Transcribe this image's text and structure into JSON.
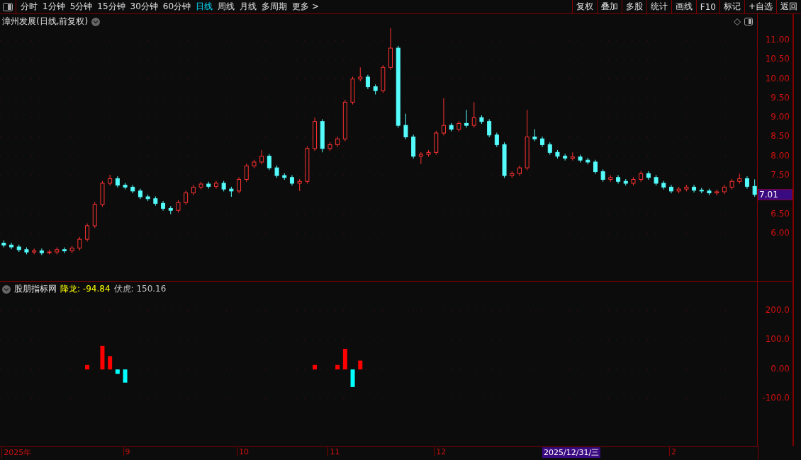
{
  "toolbar": {
    "periods": [
      {
        "label": "分时",
        "selected": false
      },
      {
        "label": "1分钟",
        "selected": false
      },
      {
        "label": "5分钟",
        "selected": false
      },
      {
        "label": "15分钟",
        "selected": false
      },
      {
        "label": "30分钟",
        "selected": false
      },
      {
        "label": "60分钟",
        "selected": false
      },
      {
        "label": "日线",
        "selected": true
      },
      {
        "label": "周线",
        "selected": false
      },
      {
        "label": "月线",
        "selected": false
      },
      {
        "label": "多周期",
        "selected": false
      },
      {
        "label": "更多 >",
        "selected": false
      }
    ],
    "buttons": [
      "复权",
      "叠加",
      "多股",
      "统计",
      "画线",
      "F10",
      "标记",
      "+自选",
      "返回"
    ]
  },
  "price_panel": {
    "title": "漳州发展(日线,前复权)",
    "current_price": "7.01",
    "chart_data": {
      "type": "candlestick",
      "categories": [
        null,
        null,
        null,
        null,
        null,
        null,
        null,
        null,
        null,
        null,
        null,
        null,
        null,
        null,
        null,
        null,
        null,
        null,
        null,
        null,
        null,
        null,
        null,
        null,
        null,
        null,
        null,
        null,
        null,
        null,
        null,
        null,
        null,
        null,
        null,
        null,
        null,
        null,
        null,
        null,
        null,
        null,
        null,
        null,
        null,
        null,
        null,
        null,
        null,
        null,
        null,
        null,
        null,
        null,
        null,
        null,
        null,
        null,
        null,
        null,
        null,
        null,
        null,
        null,
        null,
        null,
        null,
        null,
        null,
        null,
        null,
        null,
        null,
        null,
        null,
        null,
        null,
        null,
        null,
        null,
        null,
        null,
        null,
        null,
        null,
        null,
        null,
        null,
        null,
        null,
        null,
        null,
        null,
        null,
        null,
        null,
        null,
        null,
        null,
        null
      ],
      "ylim": [
        4.77,
        11.68
      ],
      "grid": true,
      "ohlc": [
        [
          5.75,
          5.82,
          5.64,
          5.7
        ],
        [
          5.7,
          5.76,
          5.59,
          5.65
        ],
        [
          5.65,
          5.71,
          5.52,
          5.58
        ],
        [
          5.58,
          5.64,
          5.46,
          5.52
        ],
        [
          5.52,
          5.61,
          5.46,
          5.55
        ],
        [
          5.55,
          5.61,
          5.44,
          5.5
        ],
        [
          5.5,
          5.58,
          5.46,
          5.52
        ],
        [
          5.52,
          5.64,
          5.46,
          5.58
        ],
        [
          5.58,
          5.64,
          5.49,
          5.55
        ],
        [
          5.55,
          5.68,
          5.49,
          5.62
        ],
        [
          5.62,
          5.91,
          5.56,
          5.85
        ],
        [
          5.85,
          6.26,
          5.79,
          6.2
        ],
        [
          6.2,
          6.81,
          6.14,
          6.75
        ],
        [
          6.75,
          7.36,
          6.69,
          7.3
        ],
        [
          7.3,
          7.52,
          7.24,
          7.42
        ],
        [
          7.42,
          7.48,
          7.19,
          7.25
        ],
        [
          7.25,
          7.31,
          7.14,
          7.2
        ],
        [
          7.2,
          7.26,
          7.04,
          7.1
        ],
        [
          7.1,
          7.16,
          6.89,
          6.95
        ],
        [
          6.95,
          7.01,
          6.84,
          6.9
        ],
        [
          6.9,
          6.96,
          6.72,
          6.78
        ],
        [
          6.78,
          6.84,
          6.59,
          6.65
        ],
        [
          6.65,
          6.71,
          6.5,
          6.6
        ],
        [
          6.6,
          6.86,
          6.54,
          6.8
        ],
        [
          6.8,
          7.11,
          6.74,
          7.05
        ],
        [
          7.05,
          7.26,
          6.99,
          7.2
        ],
        [
          7.2,
          7.34,
          7.14,
          7.28
        ],
        [
          7.28,
          7.34,
          7.16,
          7.22
        ],
        [
          7.22,
          7.36,
          7.16,
          7.3
        ],
        [
          7.3,
          7.36,
          7.09,
          7.15
        ],
        [
          7.15,
          7.21,
          6.95,
          7.1
        ],
        [
          7.1,
          7.46,
          7.04,
          7.4
        ],
        [
          7.4,
          7.81,
          7.34,
          7.75
        ],
        [
          7.75,
          7.91,
          7.69,
          7.85
        ],
        [
          7.85,
          8.16,
          7.79,
          8.0
        ],
        [
          8.0,
          8.06,
          7.64,
          7.7
        ],
        [
          7.7,
          7.76,
          7.44,
          7.5
        ],
        [
          7.5,
          7.56,
          7.39,
          7.45
        ],
        [
          7.45,
          7.51,
          7.24,
          7.3
        ],
        [
          7.3,
          7.41,
          7.1,
          7.35
        ],
        [
          7.35,
          8.26,
          7.29,
          8.2
        ],
        [
          8.2,
          9.0,
          8.14,
          8.9
        ],
        [
          8.9,
          8.96,
          8.1,
          8.2
        ],
        [
          8.2,
          8.36,
          8.14,
          8.3
        ],
        [
          8.3,
          8.51,
          8.24,
          8.45
        ],
        [
          8.45,
          9.46,
          8.39,
          9.4
        ],
        [
          9.4,
          10.06,
          9.34,
          10.0
        ],
        [
          10.0,
          10.3,
          9.94,
          10.05
        ],
        [
          10.05,
          10.11,
          9.74,
          9.8
        ],
        [
          9.8,
          9.86,
          9.6,
          9.7
        ],
        [
          9.7,
          10.36,
          9.64,
          10.3
        ],
        [
          10.3,
          11.32,
          10.24,
          10.8
        ],
        [
          10.8,
          10.86,
          8.74,
          8.8
        ],
        [
          8.8,
          9.1,
          8.44,
          8.5
        ],
        [
          8.5,
          8.56,
          7.94,
          8.0
        ],
        [
          8.0,
          8.11,
          7.8,
          8.05
        ],
        [
          8.05,
          8.16,
          7.99,
          8.1
        ],
        [
          8.1,
          8.66,
          8.04,
          8.6
        ],
        [
          8.6,
          9.5,
          8.54,
          8.8
        ],
        [
          8.8,
          8.86,
          8.64,
          8.7
        ],
        [
          8.7,
          8.91,
          8.64,
          8.85
        ],
        [
          8.85,
          9.2,
          8.74,
          8.8
        ],
        [
          8.8,
          9.4,
          8.74,
          9.0
        ],
        [
          9.0,
          9.06,
          8.84,
          8.9
        ],
        [
          8.9,
          8.96,
          8.49,
          8.55
        ],
        [
          8.55,
          8.61,
          8.24,
          8.3
        ],
        [
          8.3,
          8.36,
          7.44,
          7.5
        ],
        [
          7.5,
          7.61,
          7.44,
          7.55
        ],
        [
          7.55,
          7.76,
          7.49,
          7.7
        ],
        [
          7.7,
          9.2,
          7.64,
          8.5
        ],
        [
          8.5,
          8.7,
          8.39,
          8.45
        ],
        [
          8.45,
          8.51,
          8.24,
          8.3
        ],
        [
          8.3,
          8.36,
          8.04,
          8.1
        ],
        [
          8.1,
          8.16,
          7.94,
          8.0
        ],
        [
          8.0,
          8.06,
          7.89,
          7.95
        ],
        [
          7.95,
          8.1,
          7.89,
          7.98
        ],
        [
          7.98,
          8.04,
          7.84,
          7.9
        ],
        [
          7.9,
          7.96,
          7.79,
          7.85
        ],
        [
          7.85,
          7.91,
          7.54,
          7.6
        ],
        [
          7.6,
          7.66,
          7.34,
          7.4
        ],
        [
          7.4,
          7.51,
          7.34,
          7.45
        ],
        [
          7.45,
          7.51,
          7.29,
          7.35
        ],
        [
          7.35,
          7.41,
          7.24,
          7.3
        ],
        [
          7.3,
          7.46,
          7.24,
          7.4
        ],
        [
          7.4,
          7.61,
          7.34,
          7.55
        ],
        [
          7.55,
          7.61,
          7.39,
          7.45
        ],
        [
          7.45,
          7.51,
          7.24,
          7.3
        ],
        [
          7.3,
          7.36,
          7.14,
          7.2
        ],
        [
          7.2,
          7.26,
          7.04,
          7.1
        ],
        [
          7.1,
          7.21,
          7.04,
          7.15
        ],
        [
          7.15,
          7.26,
          7.09,
          7.2
        ],
        [
          7.2,
          7.26,
          7.06,
          7.12
        ],
        [
          7.12,
          7.18,
          7.04,
          7.1
        ],
        [
          7.1,
          7.16,
          6.99,
          7.05
        ],
        [
          7.05,
          7.14,
          6.99,
          7.08
        ],
        [
          7.08,
          7.26,
          7.02,
          7.2
        ],
        [
          7.2,
          7.41,
          7.14,
          7.35
        ],
        [
          7.35,
          7.55,
          7.29,
          7.42
        ],
        [
          7.42,
          7.48,
          7.16,
          7.22
        ],
        [
          7.22,
          7.4,
          6.95,
          7.01
        ]
      ],
      "yticks": [
        {
          "value": 11,
          "label": "11.00"
        },
        {
          "value": 10.5,
          "label": "10.50"
        },
        {
          "value": 10,
          "label": "10.00"
        },
        {
          "value": 9.5,
          "label": "9.50"
        },
        {
          "value": 9,
          "label": "9.00"
        },
        {
          "value": 8.5,
          "label": "8.50"
        },
        {
          "value": 8,
          "label": "8.00"
        },
        {
          "value": 7.5,
          "label": "7.50"
        },
        {
          "value": 6.5,
          "label": "6.50"
        },
        {
          "value": 6,
          "label": "6.00"
        }
      ]
    }
  },
  "indicator_panel": {
    "name": "股朋指标网",
    "readings": [
      {
        "label": "降龙: -94.84",
        "color": "#ffff00"
      },
      {
        "label": "伏虎: 150.16",
        "color": "#c0c0c0"
      }
    ],
    "chart_data": {
      "type": "bar",
      "ylim": [
        -262.7,
        298.8
      ],
      "grid": true,
      "values": [
        null,
        null,
        null,
        null,
        null,
        null,
        null,
        null,
        null,
        null,
        null,
        15,
        null,
        80,
        45,
        -15,
        -45,
        null,
        null,
        null,
        null,
        null,
        null,
        null,
        null,
        null,
        null,
        null,
        null,
        null,
        null,
        null,
        null,
        null,
        null,
        null,
        null,
        null,
        null,
        null,
        null,
        15,
        null,
        null,
        15,
        70,
        -60,
        30,
        null,
        null,
        null,
        null,
        null,
        null,
        null,
        null,
        null,
        null,
        null,
        null,
        null,
        null,
        null,
        null,
        null,
        null,
        null,
        null,
        null,
        null,
        null,
        null,
        null,
        null,
        null,
        null,
        null,
        null,
        null,
        null,
        null,
        null,
        null,
        null,
        null,
        null,
        null,
        null,
        null,
        null,
        null,
        null,
        null,
        null,
        null,
        null,
        null,
        null,
        null,
        null
      ],
      "yticks": [
        {
          "value": 200,
          "label": "200.0"
        },
        {
          "value": 100,
          "label": "100.0"
        },
        {
          "value": 0,
          "label": "0.00"
        },
        {
          "value": -100,
          "label": "-100.0"
        }
      ]
    }
  },
  "date_axis": {
    "labels": [
      "2025年",
      "9",
      "10",
      "11",
      "12",
      "2"
    ],
    "cursor_date": "2025/12/31/三"
  }
}
